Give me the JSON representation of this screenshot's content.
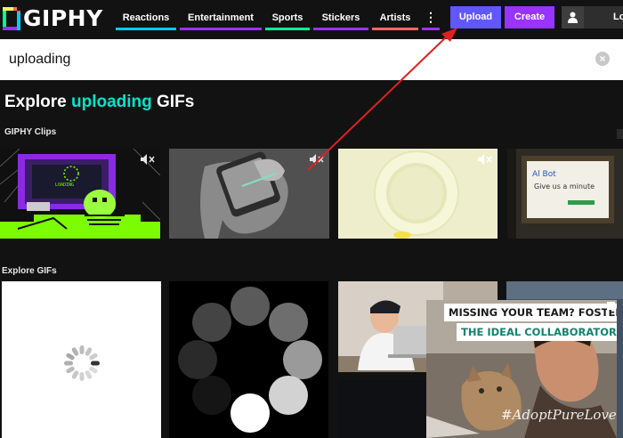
{
  "header": {
    "logo_text": "GIPHY",
    "nav": [
      {
        "label": "Reactions"
      },
      {
        "label": "Entertainment"
      },
      {
        "label": "Sports"
      },
      {
        "label": "Stickers"
      },
      {
        "label": "Artists"
      },
      {
        "label": "⋮"
      }
    ],
    "upload_label": "Upload",
    "create_label": "Create",
    "user_name": "Lo"
  },
  "search": {
    "value": "uploading",
    "clear_icon": "close-circle-icon"
  },
  "explore": {
    "title_prefix": "Explore ",
    "title_keyword": "uploading",
    "title_suffix": " GIFs"
  },
  "sections": {
    "clips_label": "GIPHY Clips",
    "gifs_label": "Explore GIFs"
  },
  "clips": [
    {
      "screen_text": "LOADING",
      "icon": "mute-icon"
    },
    {
      "icon": "mute-icon"
    },
    {
      "icon": "mute-icon"
    },
    {
      "note_line1": "Al Bot",
      "note_line2": "Give us a minute"
    }
  ],
  "ad": {
    "line1": "MISSING YOUR TEAM? FOSTER",
    "line2": "THE IDEAL COLLABORATOR.",
    "hashtag": "#AdoptPureLove"
  },
  "colors": {
    "background": "#121212",
    "upload": "#6157ff",
    "create": "#9933ff",
    "accent_keyword": "#00e6cc",
    "annotation_arrow": "#e02020"
  }
}
